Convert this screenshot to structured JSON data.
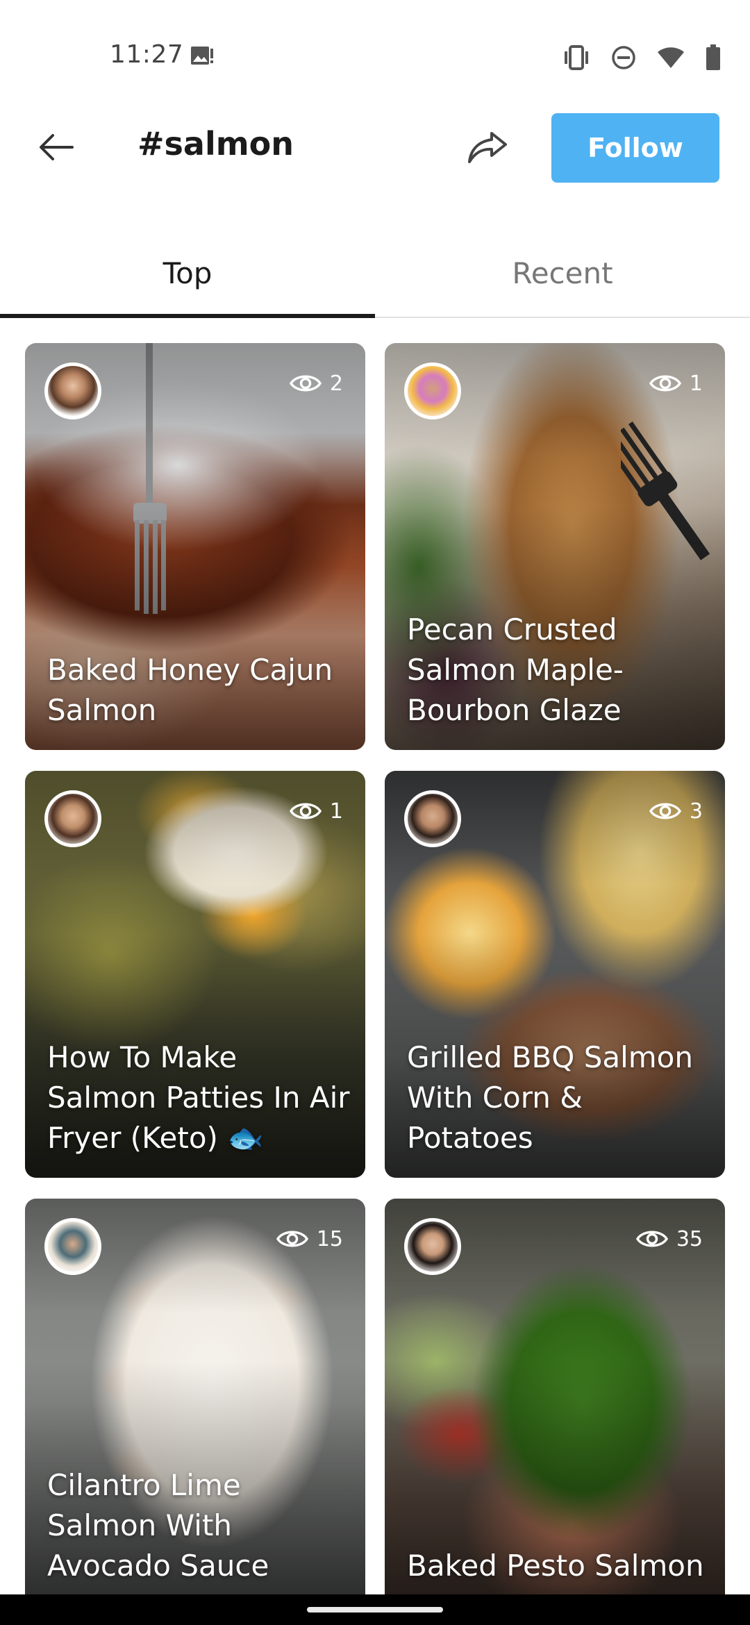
{
  "status_bar": {
    "time": "11:27",
    "icons": [
      "image-notification-icon",
      "vibrate-icon",
      "do-not-disturb-icon",
      "wifi-icon",
      "battery-icon"
    ]
  },
  "app_bar": {
    "title": "#salmon",
    "follow_label": "Follow",
    "back_icon": "arrow-left-icon",
    "share_icon": "share-icon",
    "accent_color": "#4fb2f3"
  },
  "tabs": [
    {
      "label": "Top",
      "active": true
    },
    {
      "label": "Recent",
      "active": false
    }
  ],
  "cards": [
    {
      "title": "Baked Honey Cajun Salmon",
      "views": "2"
    },
    {
      "title": "Pecan Crusted Salmon Maple-Bourbon Glaze",
      "views": "1"
    },
    {
      "title": "How To Make Salmon Patties In Air Fryer (Keto) 🐟",
      "views": "1"
    },
    {
      "title": "Grilled BBQ Salmon With Corn & Potatoes",
      "views": "3"
    },
    {
      "title": "Cilantro Lime Salmon With Avocado Sauce",
      "views": "15"
    },
    {
      "title": "Baked Pesto Salmon",
      "views": "35"
    }
  ]
}
